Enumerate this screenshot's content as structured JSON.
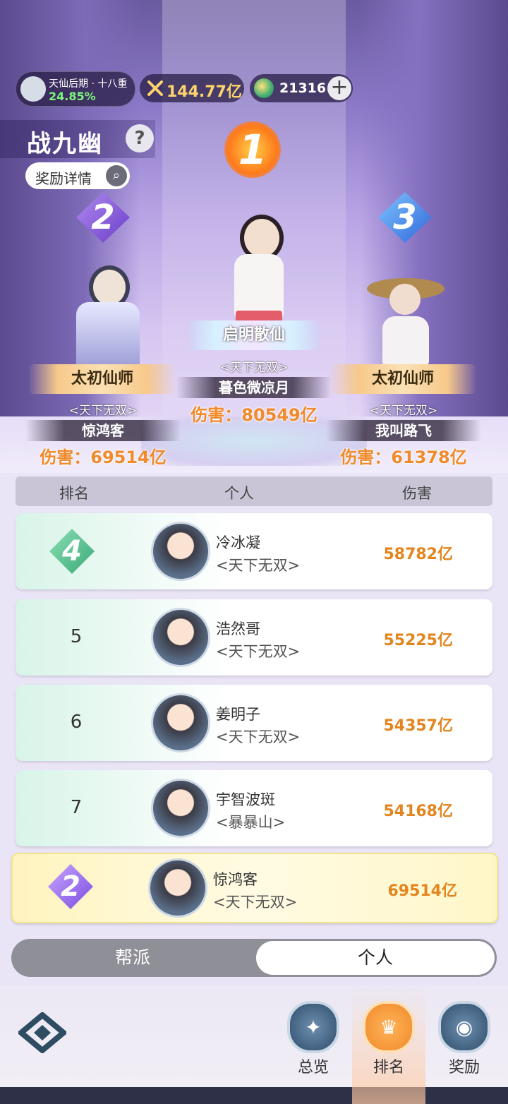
{
  "topbar": {
    "realm_title": "天仙后期 · 十八重",
    "realm_progress": "24.85%",
    "combat_power": "144.77亿",
    "currency": "21316",
    "add_label": "+"
  },
  "page": {
    "title": "战九幽",
    "help_label": "?",
    "reward_details": "奖励详情"
  },
  "podium": [
    {
      "rank": "1",
      "title": "启明散仙",
      "guild": "<天下无双>",
      "name": "暮色微凉月",
      "damage": "伤害：80549亿"
    },
    {
      "rank": "2",
      "title": "太初仙师",
      "guild": "<天下无双>",
      "name": "惊鸿客",
      "damage": "伤害：69514亿"
    },
    {
      "rank": "3",
      "title": "太初仙师",
      "guild": "<天下无双>",
      "name": "我叫路飞",
      "damage": "伤害：61378亿"
    }
  ],
  "table": {
    "headers": [
      "排名",
      "个人",
      "伤害"
    ],
    "rows": [
      {
        "rank": "4",
        "name": "冷冰凝",
        "guild": "<天下无双>",
        "damage": "58782亿"
      },
      {
        "rank": "5",
        "name": "浩然哥",
        "guild": "<天下无双>",
        "damage": "55225亿"
      },
      {
        "rank": "6",
        "name": "姜明子",
        "guild": "<天下无双>",
        "damage": "54357亿"
      },
      {
        "rank": "7",
        "name": "宇智波斑",
        "guild": "<暴暴山>",
        "damage": "54168亿"
      }
    ],
    "me": {
      "rank": "2",
      "name": "惊鸿客",
      "guild": "<天下无双>",
      "damage": "69514亿"
    }
  },
  "toggle": {
    "left": "帮派",
    "right": "个人",
    "selected": "个人"
  },
  "nav": [
    {
      "label": "总览",
      "icon": "overview-icon"
    },
    {
      "label": "排名",
      "icon": "ranking-icon",
      "active": true
    },
    {
      "label": "奖励",
      "icon": "reward-icon"
    }
  ],
  "colors": {
    "damage": "#e3851f",
    "realm_progress": "#7cf57a",
    "power": "#ffd46b",
    "nav_active": "#f39a3d"
  }
}
